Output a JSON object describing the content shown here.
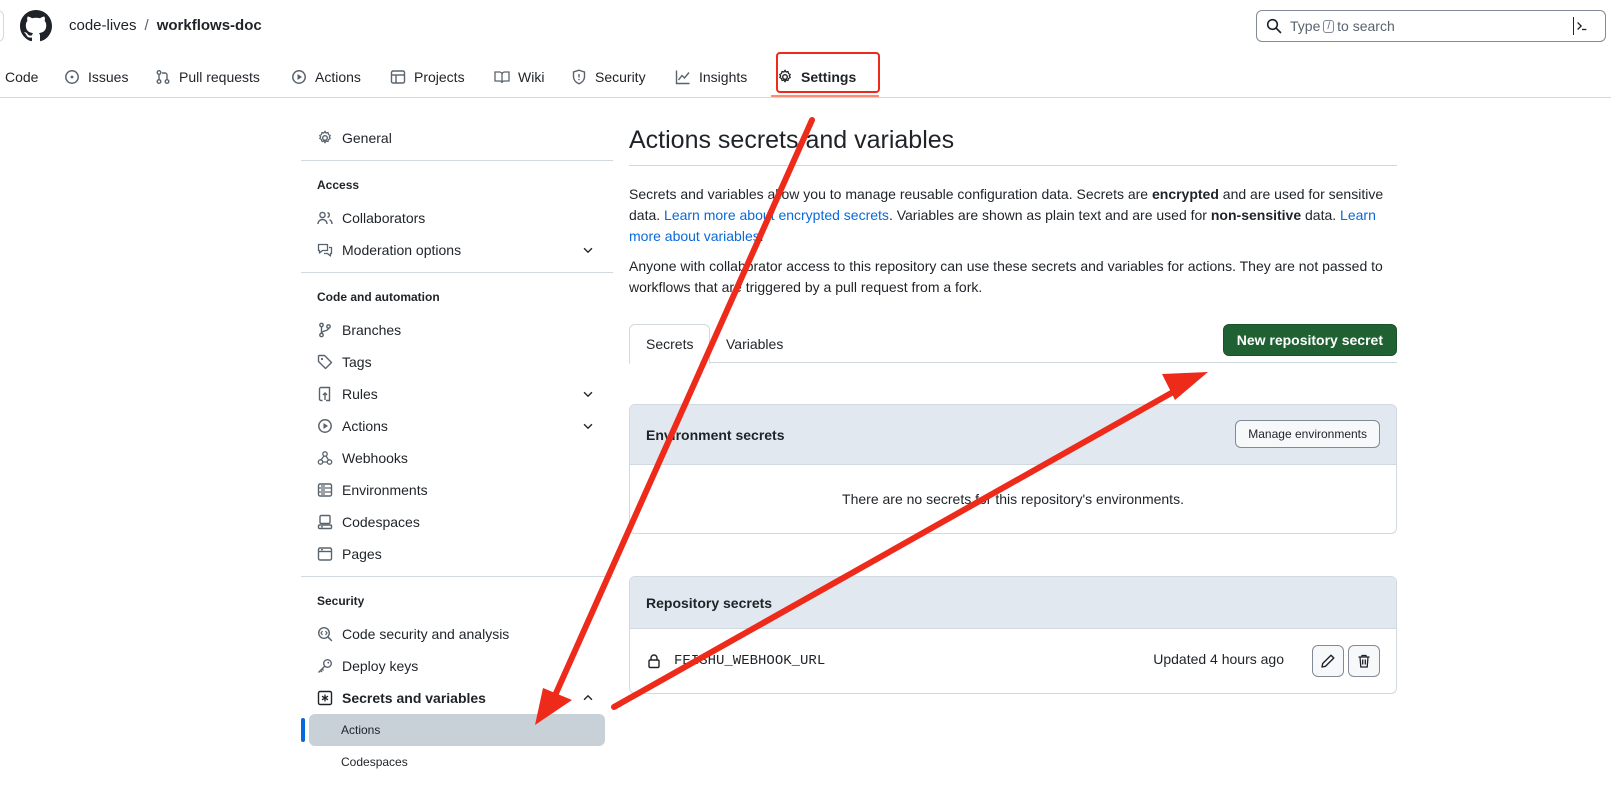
{
  "header": {
    "owner": "code-lives",
    "separator": "/",
    "repo": "workflows-doc",
    "search": {
      "pre": "Type",
      "key": "/",
      "post": "to search"
    }
  },
  "nav": {
    "items": [
      {
        "label": "Code",
        "icon": "code-icon"
      },
      {
        "label": "Issues",
        "icon": "issue-icon"
      },
      {
        "label": "Pull requests",
        "icon": "pull-request-icon"
      },
      {
        "label": "Actions",
        "icon": "play-icon"
      },
      {
        "label": "Projects",
        "icon": "table-icon"
      },
      {
        "label": "Wiki",
        "icon": "book-icon"
      },
      {
        "label": "Security",
        "icon": "shield-icon"
      },
      {
        "label": "Insights",
        "icon": "graph-icon"
      },
      {
        "label": "Settings",
        "icon": "gear-icon",
        "active": true
      }
    ]
  },
  "sidebar": {
    "general": "General",
    "access_heading": "Access",
    "collaborators": "Collaborators",
    "moderation": "Moderation options",
    "code_heading": "Code and automation",
    "branches": "Branches",
    "tags": "Tags",
    "rules": "Rules",
    "actions": "Actions",
    "webhooks": "Webhooks",
    "environments": "Environments",
    "codespaces": "Codespaces",
    "pages": "Pages",
    "security_heading": "Security",
    "code_security": "Code security and analysis",
    "deploy_keys": "Deploy keys",
    "secrets_vars": "Secrets and variables",
    "sub_actions": "Actions",
    "sub_codespaces": "Codespaces"
  },
  "main": {
    "title": "Actions secrets and variables",
    "p1": {
      "a": "Secrets and variables allow you to manage reusable configuration data. Secrets are ",
      "b": "encrypted",
      "c": " and are used for sensitive data. ",
      "link1": "Learn more about encrypted secrets",
      "d": ". Variables are shown as plain text and are used for ",
      "e": "non-sensitive",
      "f": " data. ",
      "link2": "Learn more about variables",
      "g": "."
    },
    "p2": "Anyone with collaborator access to this repository can use these secrets and variables for actions. They are not passed to workflows that are triggered by a pull request from a fork.",
    "tabs": [
      "Secrets",
      "Variables"
    ],
    "new_secret_button": "New repository secret",
    "env_secrets": {
      "title": "Environment secrets",
      "manage_button": "Manage environments",
      "empty": "There are no secrets for this repository's environments."
    },
    "repo_secrets": {
      "title": "Repository secrets",
      "rows": [
        {
          "name": "FEISHU_WEBHOOK_URL",
          "updated": "Updated 4 hours ago"
        }
      ]
    }
  },
  "colors": {
    "accent_link": "#0969da",
    "primary_button": "#1f6132",
    "annotation_red": "#ee2a1a",
    "nav_underline": "#fd8c73"
  }
}
